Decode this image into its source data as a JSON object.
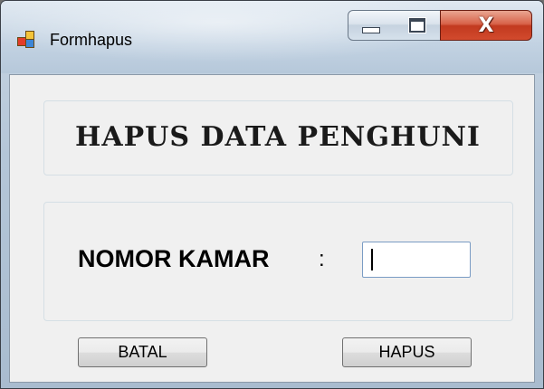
{
  "window": {
    "title": "Formhapus",
    "close_glyph": "X"
  },
  "form": {
    "heading": "HAPUS DATA PENGHUNI",
    "nomor_label": "NOMOR KAMAR",
    "colon": ":",
    "nomor_value": ""
  },
  "buttons": {
    "batal": "BATAL",
    "hapus": "HAPUS"
  },
  "icons": [
    "app-icon",
    "minimize-icon",
    "maximize-icon",
    "close-icon"
  ],
  "colors": {
    "close_button": "#c23a1f",
    "client_bg": "#f0f0f0",
    "input_border": "#7a9cc4"
  }
}
